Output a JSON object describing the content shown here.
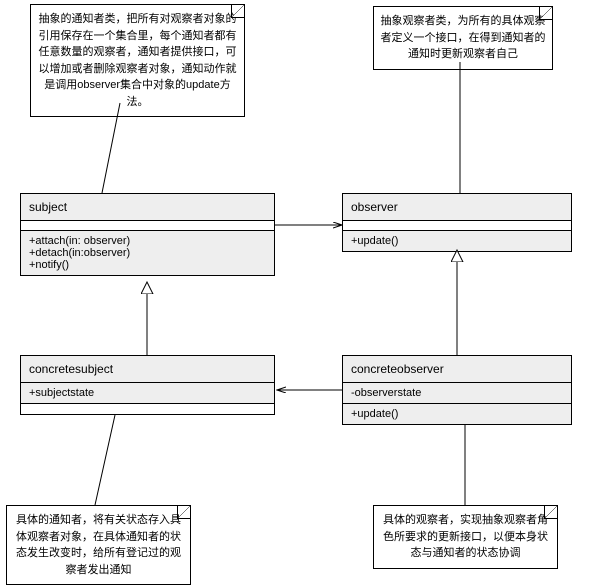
{
  "notes": {
    "subject_note": "抽象的通知者类，把所有对观察者对象的引用保存在一个集合里，每个通知者都有任意数量的观察者，通知者提供接口，可以增加或者删除观察者对象，通知动作就是调用observer集合中对象的update方法。",
    "observer_note": "抽象观察者类，为所有的具体观察者定义一个接口，在得到通知者的通知时更新观察者自己",
    "concretesubject_note": "具体的通知者，将有关状态存入具体观察者对象，在具体通知者的状态发生改变时，给所有登记过的观察者发出通知",
    "concreteobserver_note": "具体的观察者，实现抽象观察者角色所要求的更新接口，以便本身状态与通知者的状态协调"
  },
  "classes": {
    "subject": {
      "name": "subject",
      "methods": [
        "+attach(in: observer)",
        "+detach(in:observer)",
        "+notify()"
      ]
    },
    "observer": {
      "name": "observer",
      "methods": [
        "+update()"
      ]
    },
    "concretesubject": {
      "name": "concretesubject",
      "attrs": [
        "+subjectstate"
      ]
    },
    "concreteobserver": {
      "name": "concreteobserver",
      "attrs": [
        "-observerstate"
      ],
      "methods": [
        "+update()"
      ]
    }
  }
}
